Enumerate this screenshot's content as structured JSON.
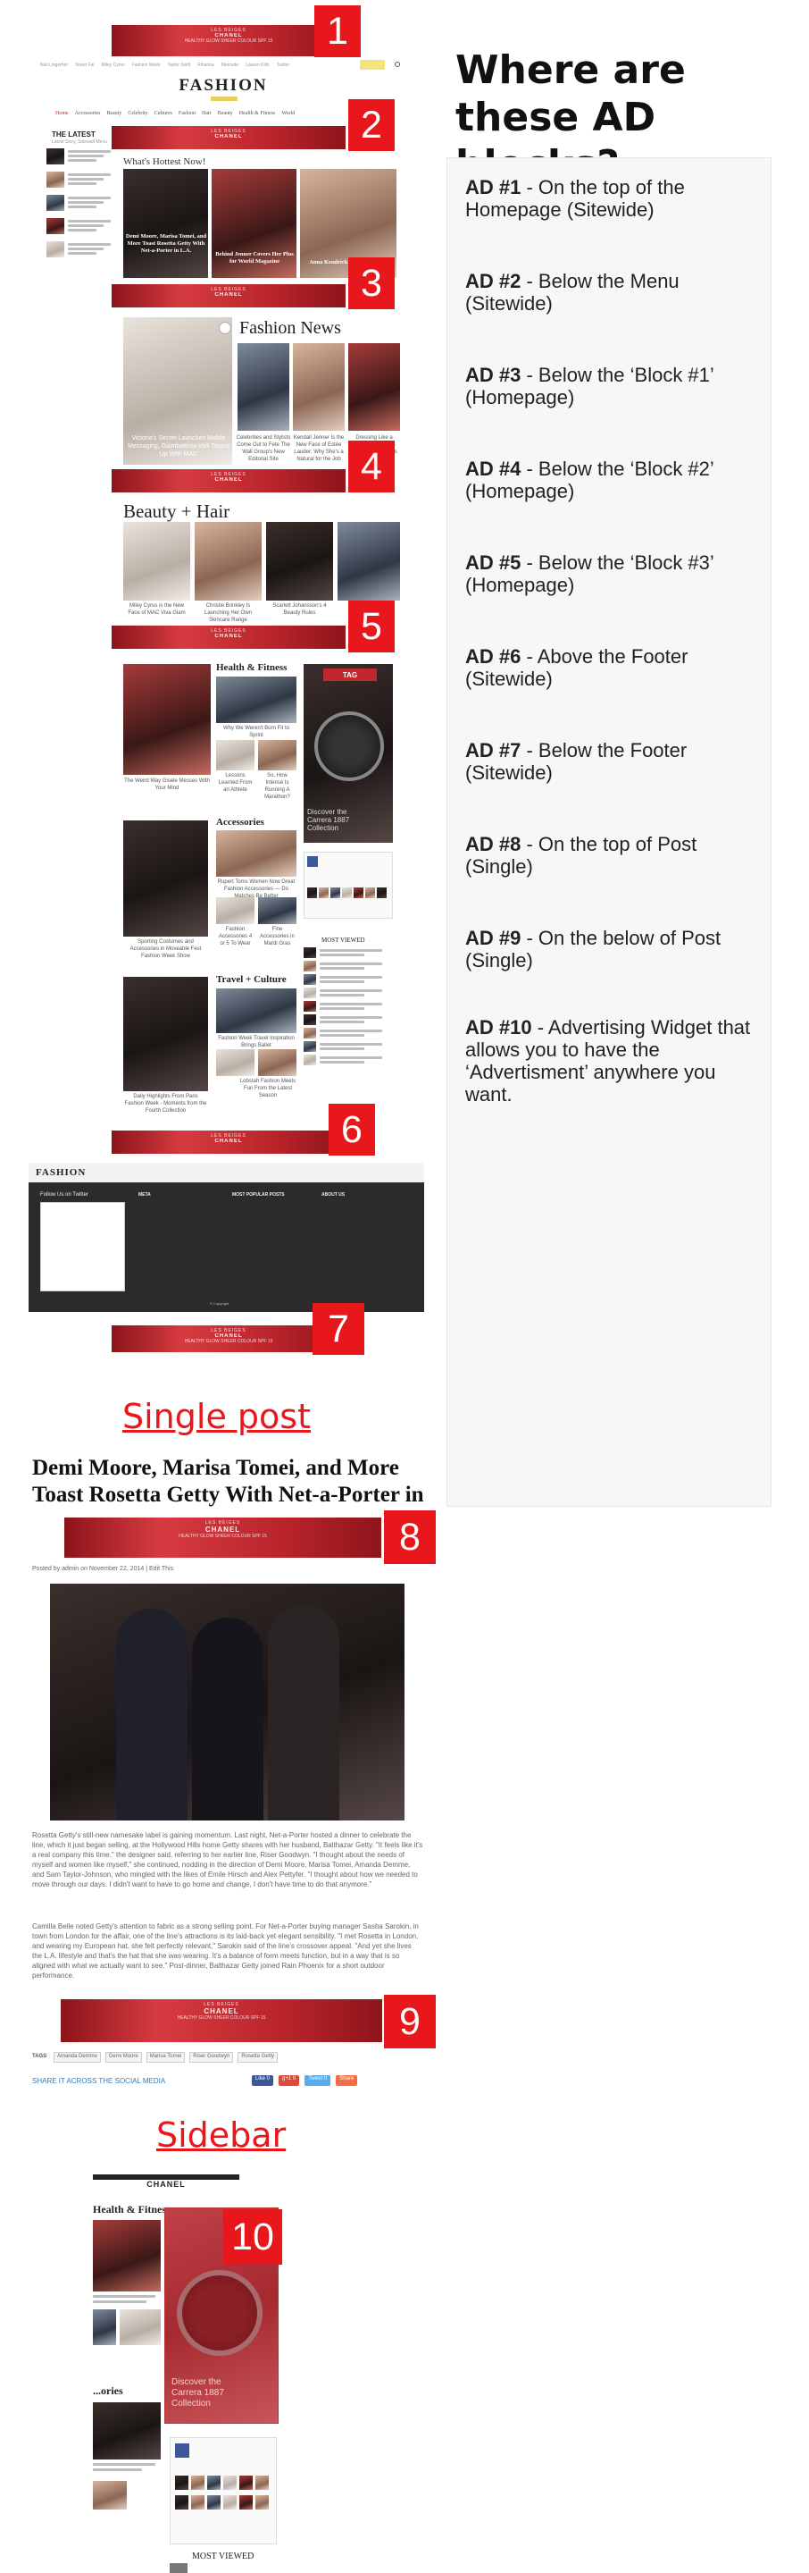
{
  "colors": {
    "accent": "#e8171b",
    "ad": "#c0282d",
    "panel": "#f7f7f7",
    "footer": "#2b2b2b",
    "share": "#2f7bbf"
  },
  "ad_banner": {
    "brand": "LES BEIGES",
    "title": "CHANEL",
    "sub": "HEALTHY GLOW SHEER COLOUR SPF 15"
  },
  "badges": [
    "1",
    "2",
    "3",
    "4",
    "5",
    "6",
    "7",
    "8",
    "9",
    "10"
  ],
  "heading": "Where are these AD blocks?",
  "ad_list": [
    {
      "label": "AD #1",
      "text": " - On the top of the Homepage (Sitewide)"
    },
    {
      "label": "AD #2",
      "text": " - Below the Menu (Sitewide)"
    },
    {
      "label": "AD #3",
      "text": " - Below the ‘Block #1’ (Homepage)"
    },
    {
      "label": "AD #4",
      "text": " - Below the ‘Block #2’ (Homepage)"
    },
    {
      "label": "AD #5",
      "text": " - Below the ‘Block #3’ (Homepage)"
    },
    {
      "label": "AD #6",
      "text": " - Above the Footer (Sitewide)"
    },
    {
      "label": "AD #7",
      "text": " - Below the Footer (Sitewide)"
    },
    {
      "label": "AD #8",
      "text": " - On the top of Post (Single)"
    },
    {
      "label": "AD #9",
      "text": " - On the below of Post (Single)"
    },
    {
      "label": "AD #10",
      "text": " - Advertising Widget that allows you to have the ‘Advertisment’ anywhere you want."
    }
  ],
  "site": {
    "logo": "FASHION",
    "topnav": [
      "Nail Lingerhet",
      "Street Fai",
      "Miley Cyrus",
      "Fashion Week",
      "Taylor Swift",
      "Rihanna",
      "Mercede",
      "Lauren Kilts",
      "Twitter"
    ],
    "menu": [
      "Home",
      "Accessories",
      "Beauty",
      "Celebrity",
      "Cultures",
      "Fashion",
      "Hair",
      "Beauty",
      "Health & Fitness",
      "World"
    ],
    "latest_title": "THE LATEST",
    "latest_sub": "Latest Story, Sidewalt Menu",
    "hottest": "What's Hottest Now!",
    "hot_caps": [
      "Demi Moore, Marisa Tomei, and More Toast Rosetta Getty With Net-a-Porter in L.A.",
      "Behind Jenner Covers Her Plus for World Magazine",
      "Anna Kendrick Collection 2014"
    ],
    "fashion_news": "Fashion News",
    "fn_caps": [
      "Victoria's Secret Launches Mobile Messaging, Giambattista Valli Teams Up With MAC",
      "Celebrities and Stylists Come Out to Fete The Wall Group's New Editorial Site",
      "Kendall Jenner Is the New Face of Estée Lauder: Why She's a Natural for the Job",
      "Dressing Like a Fashion Insider Is Easy in These Plus"
    ],
    "beauty": "Beauty + Hair",
    "beauty_caps": [
      "Miley Cyrus is the New Face of MAC Viva Glam",
      "Christie Brinkley Is Launching Her Own Skincare Range",
      "Scarlett Johansson's 4 Beauty Rules",
      "The..."
    ],
    "health": "Health & Fitness",
    "health_caps": [
      "The Weird Way Gisele Messes With Your Mind",
      "Why We Weren't Born Fit to Sprint",
      "Lessons Learned From an Athlete",
      "So, How Intense Is Running A Marathon?"
    ],
    "tag_text": "Discover the Carrera 1887 Collection",
    "accessories": "Accessories",
    "acc_caps": [
      "Sporting Costumes and Accessories in Moveable Fest Fashion Week Show",
      "Rupert Toms Women Now Great Fashion Accessories — Do Matches Be Better",
      "Fashion Accessories 4 or 5 To Wear",
      "Fine Accessories in Mardi Gras"
    ],
    "most_viewed": "MOST VIEWED",
    "travel": "Travel + Culture",
    "travel_caps": [
      "Daily Highlights From Paris Fashion Week - Moments from the Fourth Collection",
      "Fashion Week Travel Inspiration Brings Ballet",
      "Lobstah Fashion Meets Fun From the Latest Season"
    ],
    "footer_logo": "FASHION",
    "footer_cols": [
      "Follow Us on Twitter",
      "META",
      "MOST POPULAR POSTS",
      "ABOUT US"
    ],
    "copyright": "© Copyright"
  },
  "single": {
    "label": "Single post",
    "title": "Demi Moore, Marisa Tomei, and More Toast Rosetta Getty With Net-a-Porter in L.A.",
    "meta": "Posted by admin on November 22, 2014 | Edit This",
    "para1": "Rosetta Getty's still-new namesake label is gaining momentum. Last night, Net-a-Porter hosted a dinner to celebrate the line, which it just began selling, at the Hollywood Hills home Getty shares with her husband, Balthazar Getty. \"It feels like it's a real company this time,\" the designer said, referring to her earlier line, Riser Goodwyn. \"I thought about the needs of myself and women like myself,\" she continued, nodding in the direction of Demi Moore, Marisa Tomei, Amanda Demme, and Sam Taylor-Johnson, who mingled with the likes of Emile Hirsch and Alex Pettyfer. \"I thought about how we needed to move through our days. I didn't want to have to go home and change, I don't have time to do that anymore.\"",
    "para2": "Camilla Belle noted Getty's attention to fabric as a strong selling point. For Net-a-Porter buying manager Sasha Sarokin, in town from London for the affair, one of the line's attractions is its laid-back yet elegant sensibility. \"I met Rosetta in London, and wearing my European hat, she felt perfectly relevant,\" Sarokin said of the line's crossover appeal. \"And yet she lives the L.A. lifestyle and that's the hat that she was wearing. It's a balance of form meets function, but in a way that is so aligned with what we actually want to see.\" Post-dinner, Balthazar Getty joined Rain Phoenix for a short outdoor performance.",
    "tags_label": "TAGS",
    "tags": [
      "Amanda Demme",
      "Demi Moore",
      "Marisa Tomei",
      "Riser Goodwyn",
      "Rosetta Getty"
    ],
    "share": "SHARE IT ACROSS THE SOCIAL MEDIA",
    "share_btns": [
      "Like 0",
      "g+1 0",
      "Tweet 0",
      "Share"
    ]
  },
  "sidebar": {
    "label": "Sidebar",
    "health": "Health & Fitness",
    "stories": "...ories",
    "most_viewed": "MOST VIEWED",
    "tag_text": "Discover the Carrera 1887 Collection"
  }
}
